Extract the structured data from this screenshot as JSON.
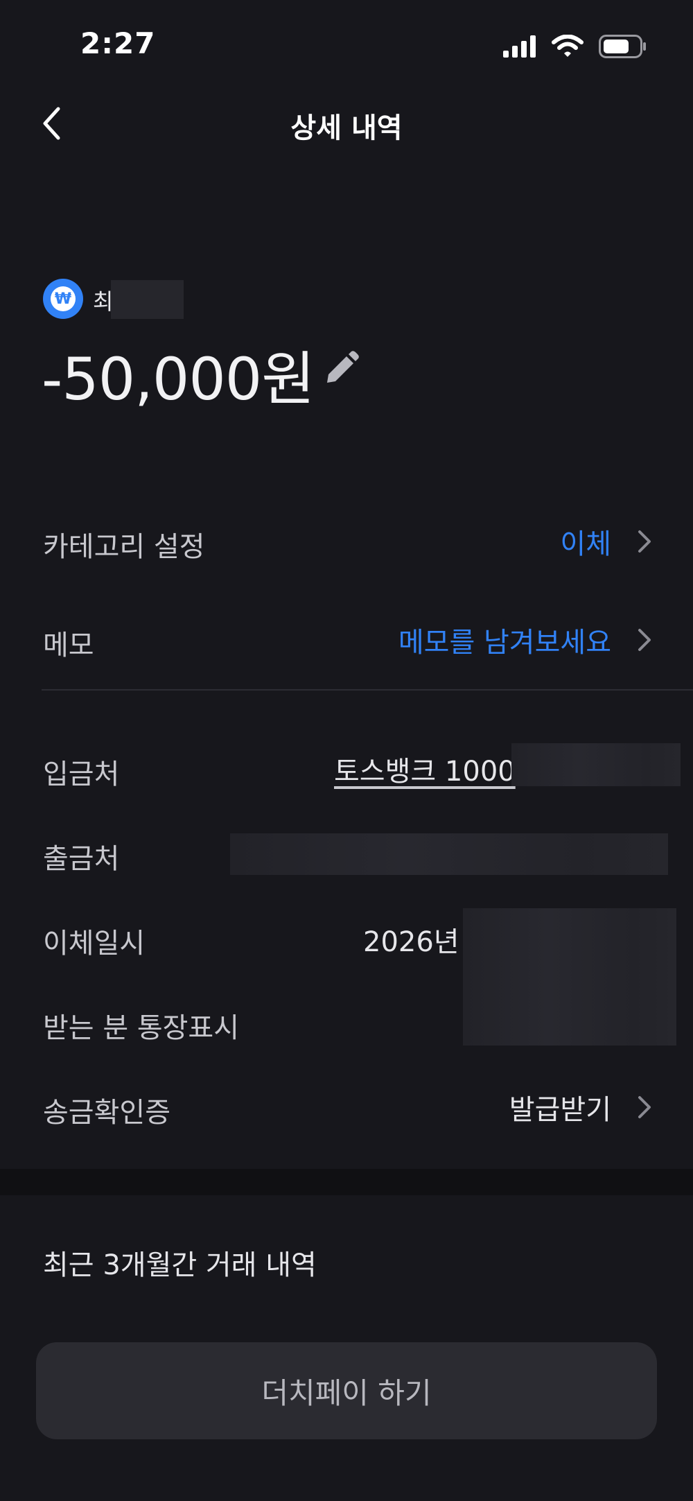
{
  "status_bar": {
    "time": "2:27"
  },
  "nav": {
    "title": "상세 내역"
  },
  "header": {
    "account_name": "최",
    "amount": "-50,000원"
  },
  "rows": {
    "category": {
      "label": "카테고리 설정",
      "value": "이체"
    },
    "memo": {
      "label": "메모",
      "value": "메모를 남겨보세요"
    },
    "deposit_to": {
      "label": "입금처",
      "value": "토스뱅크 1000"
    },
    "withdraw_from": {
      "label": "출금처"
    },
    "transfer_datetime": {
      "label": "이체일시",
      "value": "2026년"
    },
    "recipient_display": {
      "label": "받는 분 통장표시"
    },
    "remittance_cert": {
      "label": "송금확인증",
      "value": "발급받기"
    }
  },
  "recent_section": {
    "title": "최근 3개월간 거래 내역"
  },
  "dutch_pay": {
    "label": "더치페이 하기"
  },
  "icons": {
    "bank": "won-coin-icon",
    "edit": "pencil-icon",
    "back": "chevron-left-icon",
    "chevron": "chevron-right-icon"
  },
  "colors": {
    "accent": "#3182f6",
    "background": "#17171c"
  }
}
